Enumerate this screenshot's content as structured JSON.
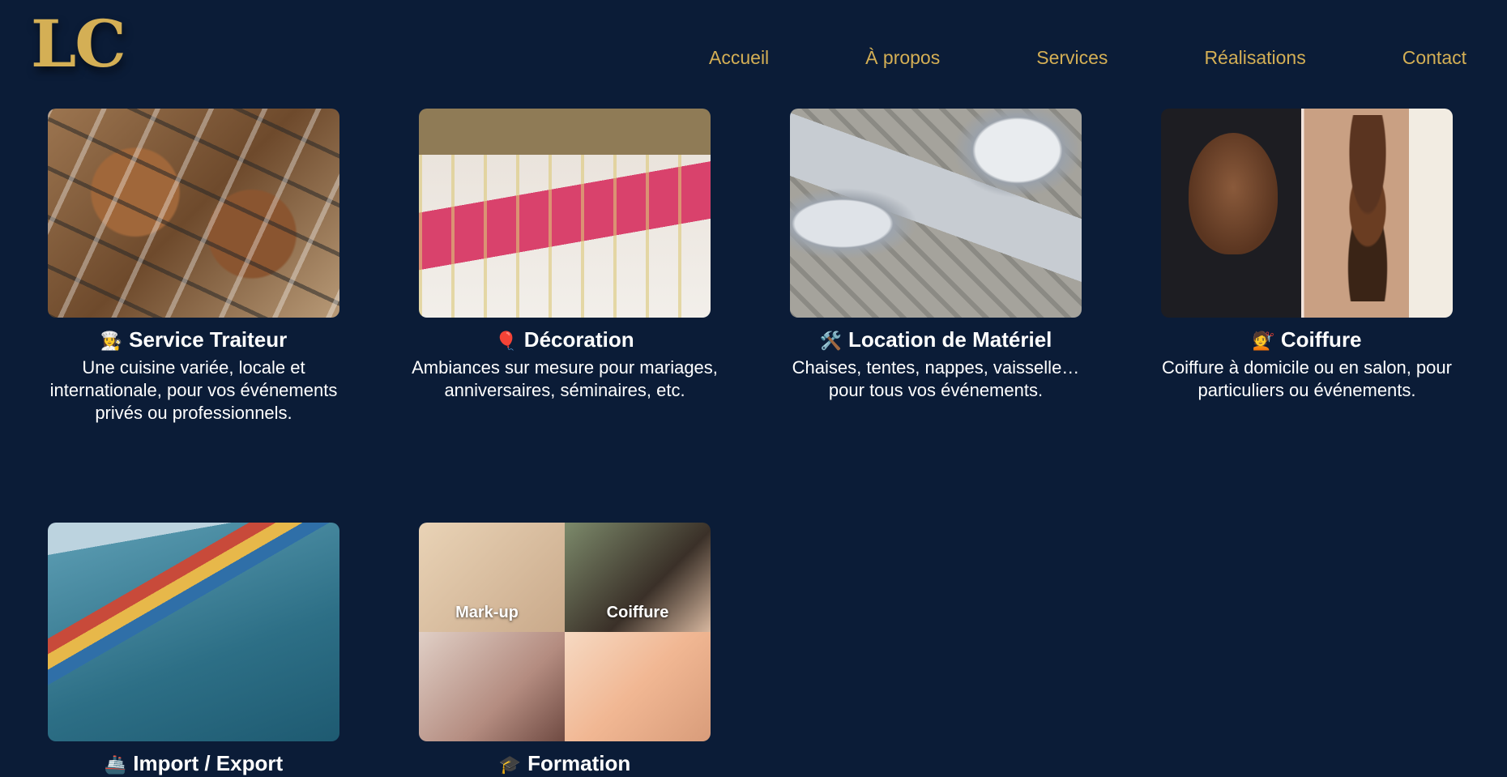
{
  "brand": {
    "logo_text": "LC",
    "accent": "#d4af55",
    "background": "#0b1c37"
  },
  "nav": {
    "items": [
      "Accueil",
      "À propos",
      "Services",
      "Réalisations",
      "Contact"
    ]
  },
  "services": [
    {
      "icon": "cook-icon",
      "emoji": "👩‍🍳",
      "title": "Service Traiteur",
      "description": "Une cuisine variée, locale et internationale, pour vos événements privés ou professionnels."
    },
    {
      "icon": "balloon-icon",
      "emoji": "🎈",
      "title": "Décoration",
      "description": "Ambiances sur mesure pour mariages, anniversaires, séminaires, etc."
    },
    {
      "icon": "tools-icon",
      "emoji": "🛠️",
      "title": "Location de Matériel",
      "description": "Chaises, tentes, nappes, vaisselle… pour tous vos événements."
    },
    {
      "icon": "hairdresser-icon",
      "emoji": "💇",
      "title": "Coiffure",
      "description": "Coiffure à domicile ou en salon, pour particuliers ou événements."
    },
    {
      "icon": "ship-icon",
      "emoji": "🚢",
      "title": "Import / Export",
      "description": ""
    },
    {
      "icon": "graduation-cap-icon",
      "emoji": "🎓",
      "title": "Formation",
      "description": "",
      "image_labels": [
        "Mark-up",
        "Coiffure"
      ]
    }
  ]
}
